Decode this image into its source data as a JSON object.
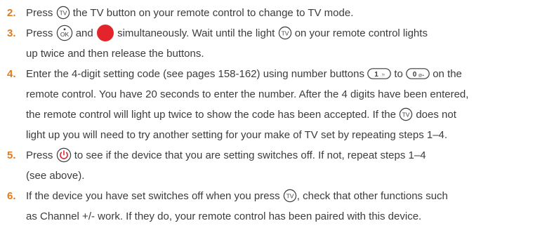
{
  "steps": [
    {
      "number": "2.",
      "lines": [
        {
          "a": "Press",
          "b": "the TV button on your remote control to change to TV mode."
        }
      ]
    },
    {
      "number": "3.",
      "lines": [
        {
          "a": "Press",
          "b": "and",
          "c": "simultaneously. Wait until the light",
          "d": "on your remote control lights"
        },
        {
          "a": "up twice and then release the buttons."
        }
      ]
    },
    {
      "number": "4.",
      "lines": [
        {
          "a": "Enter the 4-digit setting code (see pages 158-162) using number buttons",
          "b": "to",
          "c": "on the"
        },
        {
          "a": "remote control. You have 20 seconds to enter the number. After the 4 digits have been entered,"
        },
        {
          "a": "the remote control will light up twice to show the code has been accepted. If the",
          "b": "does not"
        },
        {
          "a": "light up you will need to try another setting for your make of TV set by repeating steps 1–4."
        }
      ]
    },
    {
      "number": "5.",
      "lines": [
        {
          "a": "Press",
          "b": "to see if the device that you are setting switches off. If not, repeat steps 1–4"
        },
        {
          "a": "(see above)."
        }
      ]
    },
    {
      "number": "6.",
      "lines": [
        {
          "a": "If the device you have set switches off when you press",
          "b": ", check that other functions such"
        },
        {
          "a": "as Channel +/- work.  If they do, your remote control has been paired with this device."
        }
      ]
    }
  ],
  "icons": {
    "tv_label": "TV",
    "ok_label": "OK",
    "key1_label": "1",
    "key1_sub": ".?!",
    "key0_label": "0",
    "key0_sub": "@+"
  },
  "colors": {
    "step_number": "#e27a1a",
    "body_text": "#3c3c3c",
    "red_button": "#e4242b"
  }
}
